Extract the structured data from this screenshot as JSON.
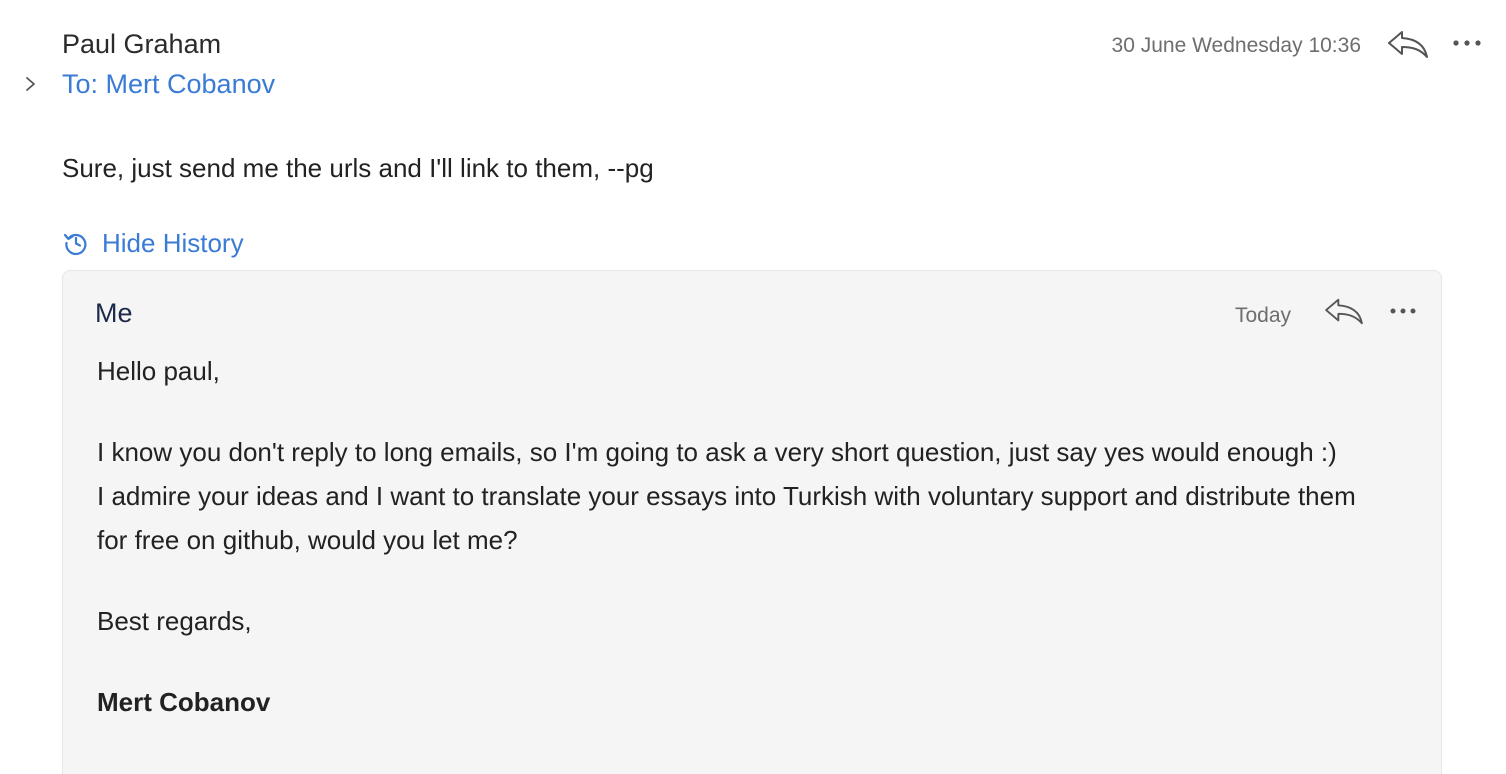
{
  "message": {
    "sender": "Paul Graham",
    "to": "To: Mert Cobanov",
    "date": "30 June Wednesday 10:36",
    "body": "Sure, just send me the urls and I'll link to them, --pg",
    "icons": {
      "expand": "chevron-right-icon",
      "reply": "reply-icon",
      "more": "more-options-icon"
    }
  },
  "history_toggle": {
    "label": "Hide History",
    "icon": "history-icon"
  },
  "quoted": {
    "sender": "Me",
    "date": "Today",
    "greeting": "Hello paul,",
    "paragraph1": "I know you don't reply to long emails, so I'm going to ask a very short question, just say yes would enough :)",
    "paragraph2": "I admire your ideas and I want to translate your essays into Turkish with voluntary support and distribute them for free on github, would you let me?",
    "closing": "Best regards,",
    "signature": "Mert Cobanov"
  },
  "colors": {
    "link": "#3a7bd5",
    "quoted_background": "#f5f5f5",
    "muted_text": "#6e6e6e"
  }
}
